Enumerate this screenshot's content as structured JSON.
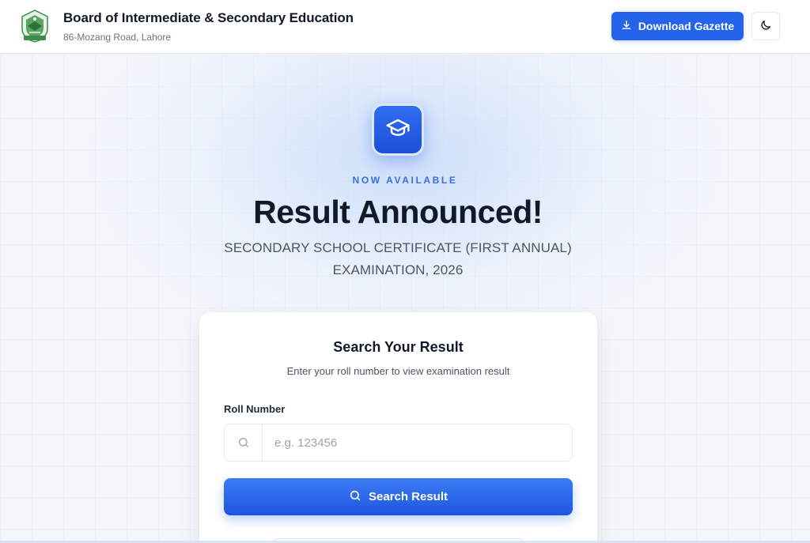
{
  "header": {
    "title": "Board of Intermediate & Secondary Education",
    "address": "86-Mozang Road, Lahore",
    "download_label": "Download Gazette",
    "icons": {
      "logo": "board-logo",
      "download": "download-icon",
      "theme": "moon-icon"
    }
  },
  "hero": {
    "badge_icon": "graduation-cap-icon",
    "eyebrow": "NOW AVAILABLE",
    "headline": "Result Announced!",
    "subline": "SECONDARY SCHOOL CERTIFICATE (FIRST ANNUAL) EXAMINATION, 2026"
  },
  "search_card": {
    "title": "Search Your Result",
    "subtitle": "Enter your roll number to view examination result",
    "field_label": "Roll Number",
    "input_value": "",
    "input_placeholder": "e.g. 123456",
    "button_label": "Search Result",
    "icons": {
      "input": "search-icon",
      "button": "search-icon"
    }
  },
  "colors": {
    "primary": "#2563eb",
    "eyebrow": "#3b6fd8",
    "logo_green": "#3d8b4f"
  }
}
